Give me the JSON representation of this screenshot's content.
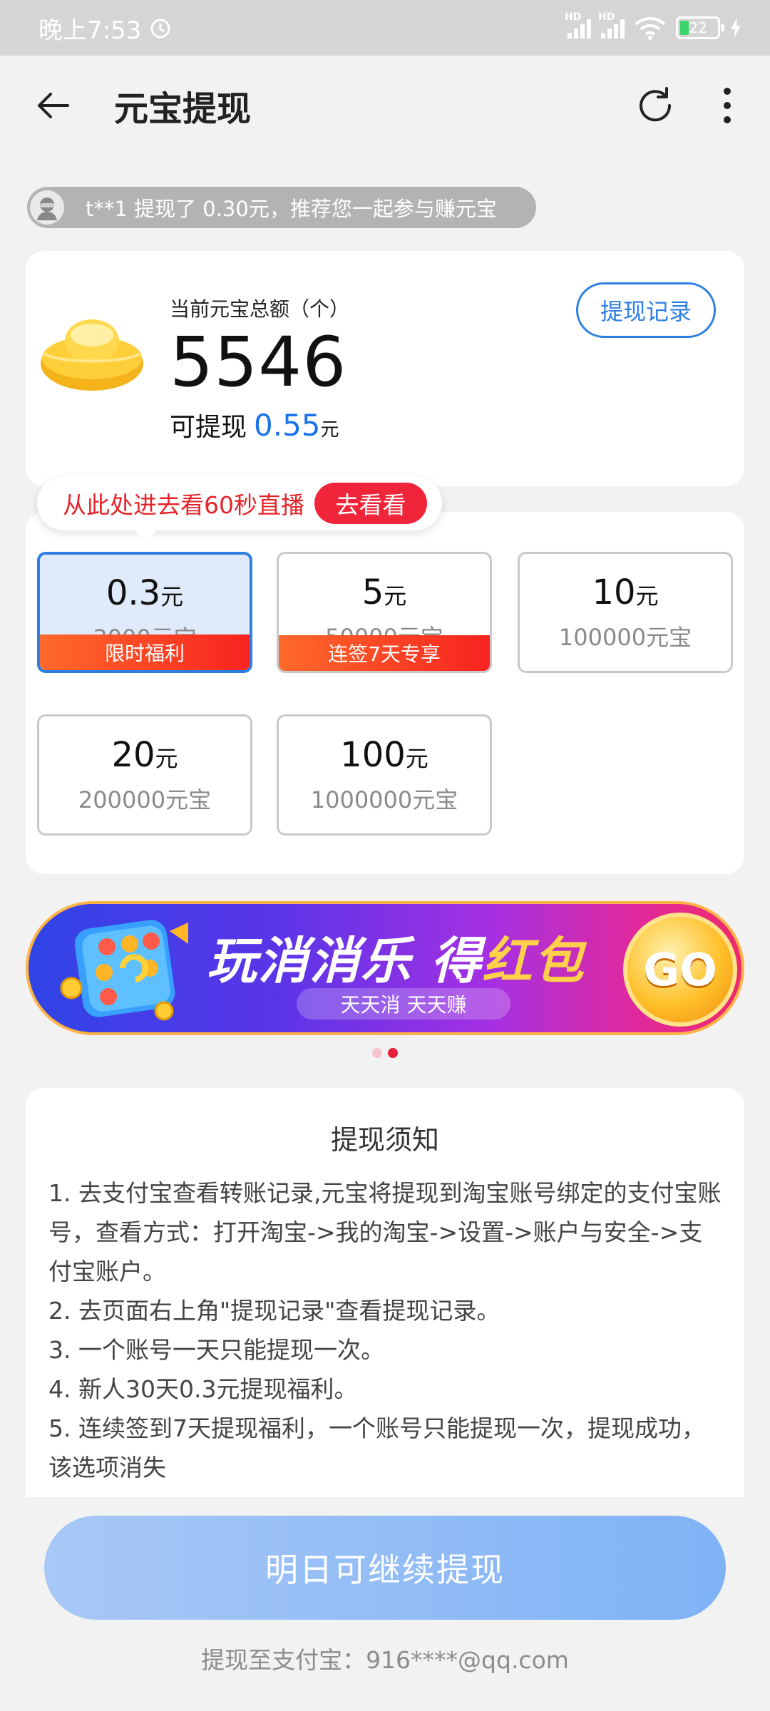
{
  "status_bar": {
    "time": "晚上7:53",
    "signal1_label": "HD",
    "signal2_label": "HD",
    "battery": "22"
  },
  "header": {
    "title": "元宝提现",
    "back_icon": "arrow-left-icon",
    "refresh_icon": "refresh-icon",
    "more_icon": "more-vertical-icon"
  },
  "ticker": {
    "text": "t**1 提现了 0.30元，推荐您一起参与赚元宝"
  },
  "balance": {
    "label": "当前元宝总额（个）",
    "value": "5546",
    "withdrawable_label": "可提现",
    "withdrawable_amount": "0.55",
    "withdrawable_unit": "元",
    "records_button": "提现记录"
  },
  "live_tip": {
    "text": "从此处进去看60秒直播",
    "button": "去看看"
  },
  "options": [
    {
      "amount": "0.3",
      "unit": "元",
      "cost": "3000元宝",
      "tag": "限时福利",
      "selected": true
    },
    {
      "amount": "5",
      "unit": "元",
      "cost": "50000元宝",
      "tag": "连签7天专享",
      "selected": false
    },
    {
      "amount": "10",
      "unit": "元",
      "cost": "100000元宝",
      "tag": "",
      "selected": false
    },
    {
      "amount": "20",
      "unit": "元",
      "cost": "200000元宝",
      "tag": "",
      "selected": false
    },
    {
      "amount": "100",
      "unit": "元",
      "cost": "1000000元宝",
      "tag": "",
      "selected": false
    }
  ],
  "banner": {
    "headline_main": "玩消消乐 得",
    "headline_highlight": "红包",
    "sub": "天天消 天天赚",
    "go": "GO"
  },
  "notice": {
    "title": "提现须知",
    "items": [
      "1. 去支付宝查看转账记录,元宝将提现到淘宝账号绑定的支付宝账号，查看方式：打开淘宝->我的淘宝->设置->账户与安全->支付宝账户。",
      "2. 去页面右上角\"提现记录\"查看提现记录。",
      "3. 一个账号一天只能提现一次。",
      "4. 新人30天0.3元提现福利。",
      "5. 连续签到7天提现福利，一个账号只能提现一次，提现成功，该选项消失"
    ]
  },
  "cta": {
    "label": "明日可继续提现"
  },
  "destination": {
    "text": "提现至支付宝：916****@qq.com"
  },
  "colors": {
    "accent_blue": "#1a73e8",
    "red": "#f0253a",
    "page_bg": "#f2f2f2"
  }
}
